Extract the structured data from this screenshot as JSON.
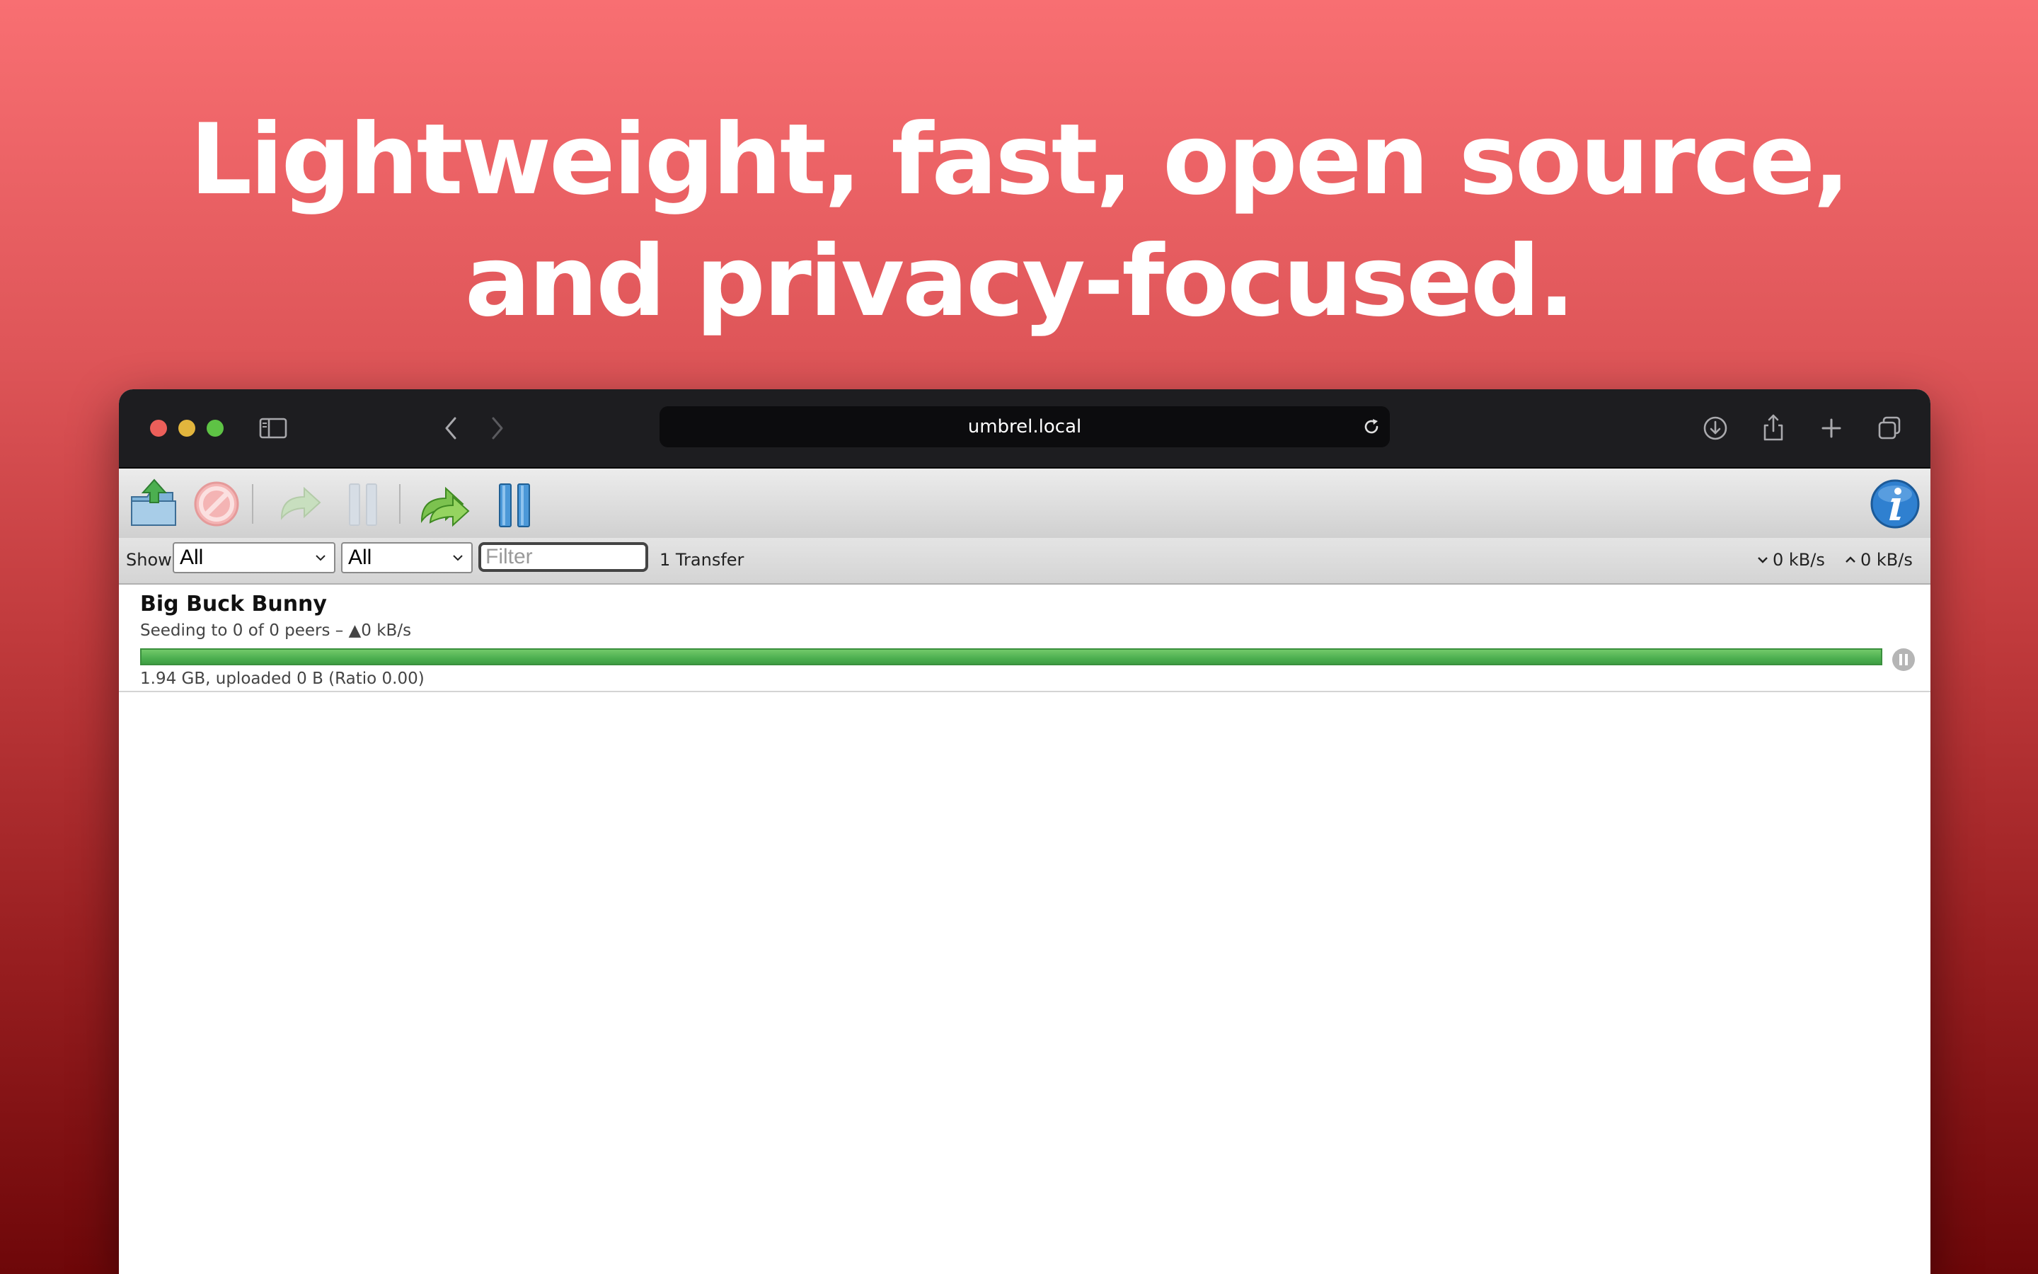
{
  "headline": {
    "line1": "Lightweight, fast, open source,",
    "line2": "and privacy-focused."
  },
  "browser": {
    "url": "umbrel.local",
    "traffic_lights": {
      "close": "#ec5f5a",
      "minimize": "#e2b53d",
      "zoom": "#5ec345"
    },
    "icons": [
      "sidebar-icon",
      "back-icon",
      "forward-icon",
      "reload-icon",
      "download-icon",
      "share-icon",
      "new-tab-icon",
      "tabs-overview-icon"
    ]
  },
  "toolbar": {
    "buttons": [
      "open-torrent",
      "remove",
      "resume",
      "pause",
      "resume-all",
      "pause-all",
      "inspector"
    ]
  },
  "filterbar": {
    "show_label": "Show",
    "state_filter": "All",
    "tracker_filter": "All",
    "filter_placeholder": "Filter",
    "transfer_count": "1 Transfer",
    "download_speed": "0 kB/s",
    "upload_speed": "0 kB/s"
  },
  "torrents": [
    {
      "name": "Big Buck Bunny",
      "status": "Seeding to 0 of 0 peers – ▲0 kB/s",
      "progress": 1.0,
      "details": "1.94 GB, uploaded 0 B (Ratio 0.00)"
    }
  ],
  "colors": {
    "progress_seeding": "#4caf50",
    "titlebar": "#1d1d20",
    "accent_info": "#2f80d0"
  }
}
